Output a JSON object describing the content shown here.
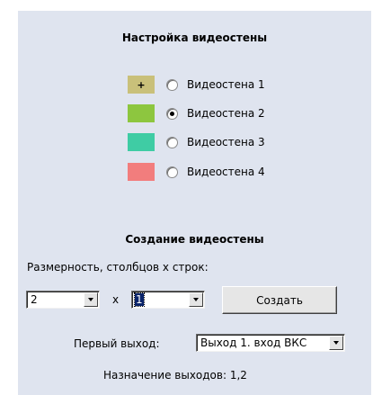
{
  "setup": {
    "title": "Настройка видеостены",
    "walls": [
      {
        "label": "Видеостена 1",
        "color": "#c9c07a",
        "marker": "+",
        "checked": false
      },
      {
        "label": "Видеостена 2",
        "color": "#8dc63f",
        "marker": "",
        "checked": true
      },
      {
        "label": "Видеостена 3",
        "color": "#3fcca4",
        "marker": "",
        "checked": false
      },
      {
        "label": "Видеостена 4",
        "color": "#f27d7d",
        "marker": "",
        "checked": false
      }
    ]
  },
  "create": {
    "title": "Создание видеостены",
    "dimension_label": "Размерность, столбцов x строк:",
    "columns_value": "2",
    "times_sign": "x",
    "rows_value": "1",
    "create_button": "Создать",
    "first_output_label": "Первый выход:",
    "first_output_value": "Выход 1. вход ВКС",
    "assignment_text": "Назначение выходов: 1,2"
  }
}
